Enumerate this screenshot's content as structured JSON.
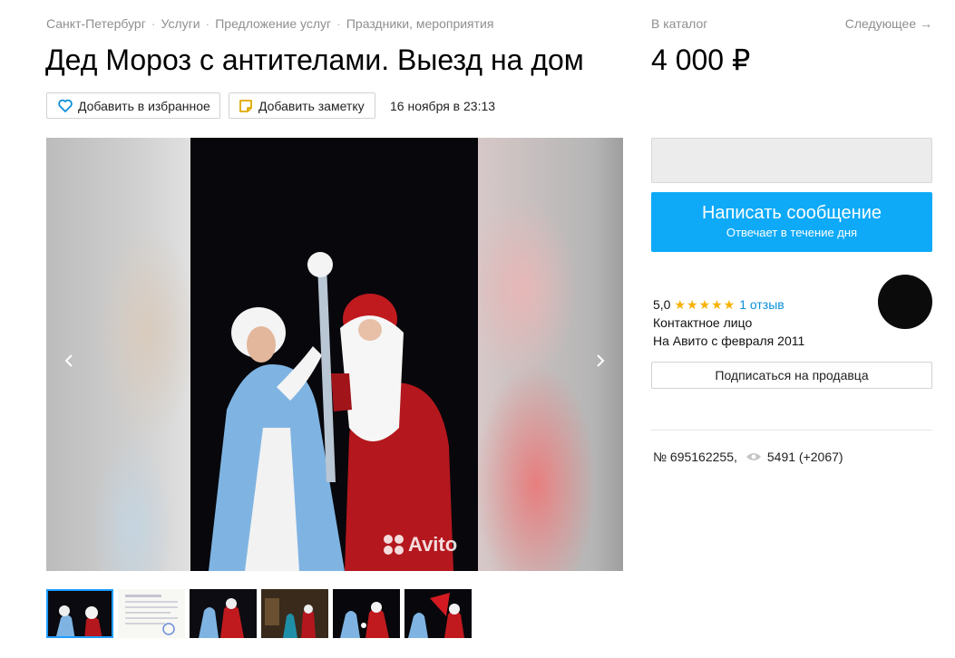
{
  "breadcrumbs": [
    "Санкт-Петербург",
    "Услуги",
    "Предложение услуг",
    "Праздники, мероприятия"
  ],
  "catalog_link": "В каталог",
  "next_link": "Следующее →",
  "title": "Дед Мороз с антителами. Выезд на дом",
  "price": "4 000 ₽",
  "actions": {
    "favorite_label": "Добавить в избранное",
    "note_label": "Добавить заметку",
    "date": "16 ноября в 23:13"
  },
  "gallery": {
    "watermark": "Avito",
    "prev_icon": "chevron-left-icon",
    "next_icon": "chevron-right-icon",
    "thumbnails": [
      "photo-1",
      "document-scan",
      "photo-3",
      "photo-4",
      "photo-5",
      "photo-6"
    ]
  },
  "contact": {
    "message_button": "Написать сообщение",
    "message_sub": "Отвечает в течение дня"
  },
  "seller": {
    "rating": "5,0",
    "stars": "★★★★★",
    "reviews": "1 отзыв",
    "type": "Контактное лицо",
    "since": "На Авито с февраля 2011",
    "subscribe": "Подписаться на продавца"
  },
  "stats": {
    "ad_number": "№ 695162255,",
    "views": "5491 (+2067)"
  },
  "colors": {
    "accent": "#0eaaf8",
    "star": "#f7b100",
    "link": "#0a8fd8"
  }
}
